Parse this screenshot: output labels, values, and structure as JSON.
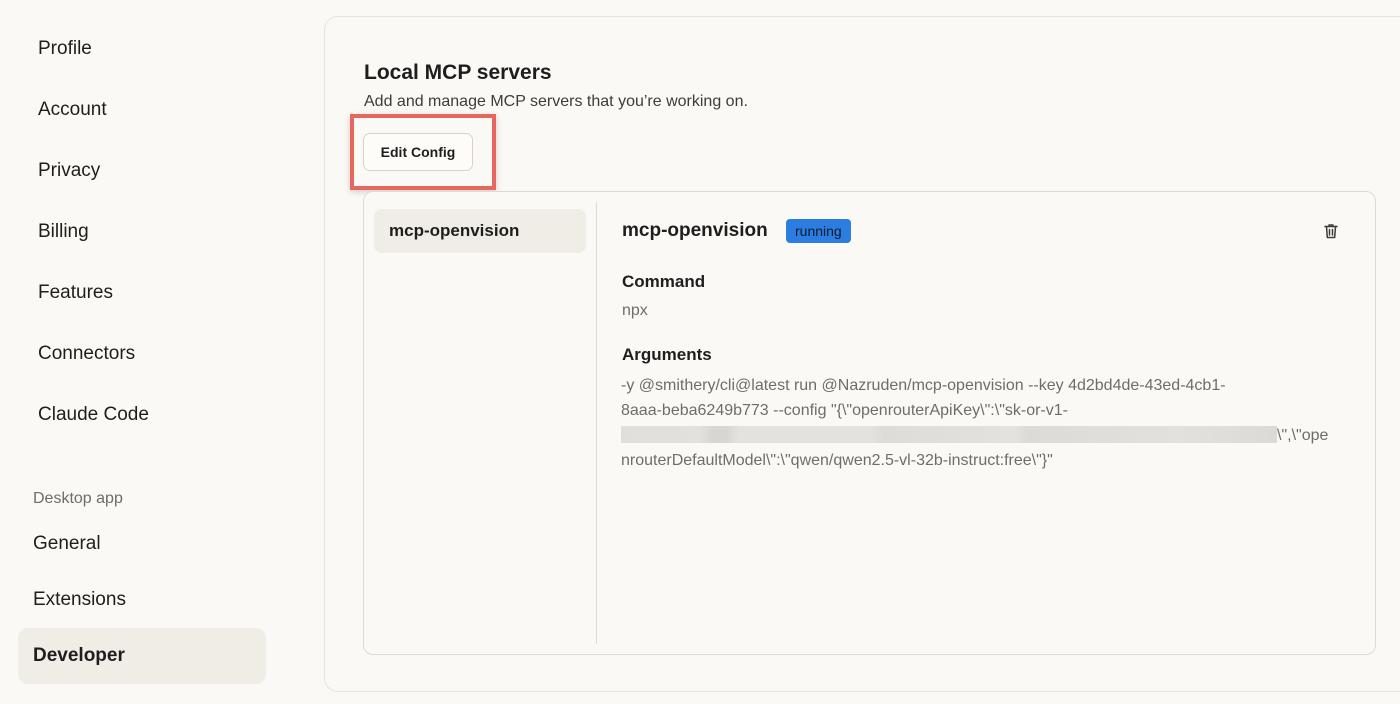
{
  "sidebar": {
    "items": [
      {
        "label": "Profile"
      },
      {
        "label": "Account"
      },
      {
        "label": "Privacy"
      },
      {
        "label": "Billing"
      },
      {
        "label": "Features"
      },
      {
        "label": "Connectors"
      },
      {
        "label": "Claude Code"
      }
    ],
    "desktop_section_label": "Desktop app",
    "desktop_items": [
      {
        "label": "General"
      },
      {
        "label": "Extensions"
      },
      {
        "label": "Developer",
        "active": true
      }
    ]
  },
  "main": {
    "title": "Local MCP servers",
    "subtitle": "Add and manage MCP servers that you’re working on.",
    "edit_config_label": "Edit Config",
    "servers": [
      {
        "name": "mcp-openvision"
      }
    ],
    "detail": {
      "name": "mcp-openvision",
      "status": "running",
      "status_color": "#2b7de0",
      "command_label": "Command",
      "command_value": "npx",
      "arguments_label": "Arguments",
      "arguments_lines": [
        "-y @smithery/cli@latest run @Nazruden/mcp-openvision --key 4d2bd4de-43ed-4cb1-",
        "8aaa-beba6249b773 --config \"{\\\"openrouterApiKey\\\":\\\"sk-or-v1-",
        "\\\",\\\"ope",
        "nrouterDefaultModel\\\":\\\"qwen/qwen2.5-vl-32b-instruct:free\\\"}\""
      ],
      "delete_icon": "trash-icon"
    }
  },
  "colors": {
    "highlight": "#e8665c",
    "active_bg": "#efede6",
    "badge": "#2b7de0"
  }
}
